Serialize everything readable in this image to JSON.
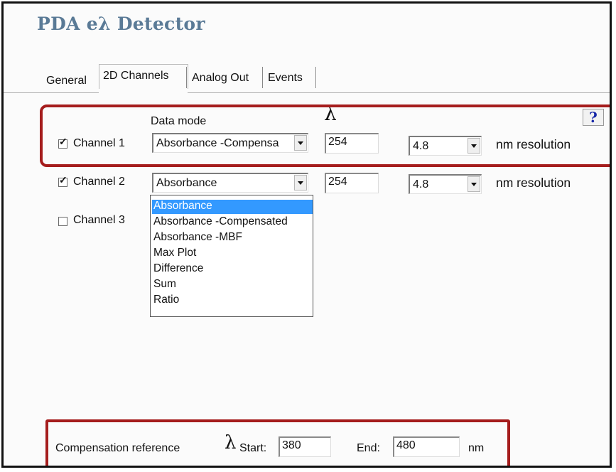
{
  "title": "PDA eλ Detector",
  "tabs": [
    {
      "label": "General"
    },
    {
      "label": "2D Channels",
      "active": true
    },
    {
      "label": "Analog Out"
    },
    {
      "label": "Events"
    }
  ],
  "header": {
    "data_mode_label": "Data mode",
    "lambda_symbol": "λ",
    "help_label": "?"
  },
  "channels": [
    {
      "label": "Channel 1",
      "checked": true,
      "data_mode": "Absorbance -Compensa",
      "wavelength": "254",
      "resolution": "4.8",
      "resolution_suffix": "nm resolution"
    },
    {
      "label": "Channel 2",
      "checked": true,
      "data_mode": "Absorbance",
      "wavelength": "254",
      "resolution": "4.8",
      "resolution_suffix": "nm resolution"
    },
    {
      "label": "Channel 3",
      "checked": false
    }
  ],
  "check_mark": "✓",
  "data_mode_options": [
    "Absorbance",
    "Absorbance -Compensated",
    "Absorbance -MBF",
    "Max Plot",
    "Difference",
    "Sum",
    "Ratio"
  ],
  "selected_option": "Absorbance",
  "compensation": {
    "label": "Compensation reference",
    "lambda_symbol": "λ",
    "start_label": "Start:",
    "start_value": "380",
    "end_label": "End:",
    "end_value": "480",
    "unit": "nm"
  },
  "colors": {
    "title": "#5a7a96",
    "highlight_box": "#a51d1d",
    "selected_item_bg": "#3399ff",
    "help_icon": "#1626a8"
  },
  "icons": {
    "help": "question-mark-icon",
    "dropdown": "chevron-down-icon",
    "check": "checkmark-icon"
  }
}
